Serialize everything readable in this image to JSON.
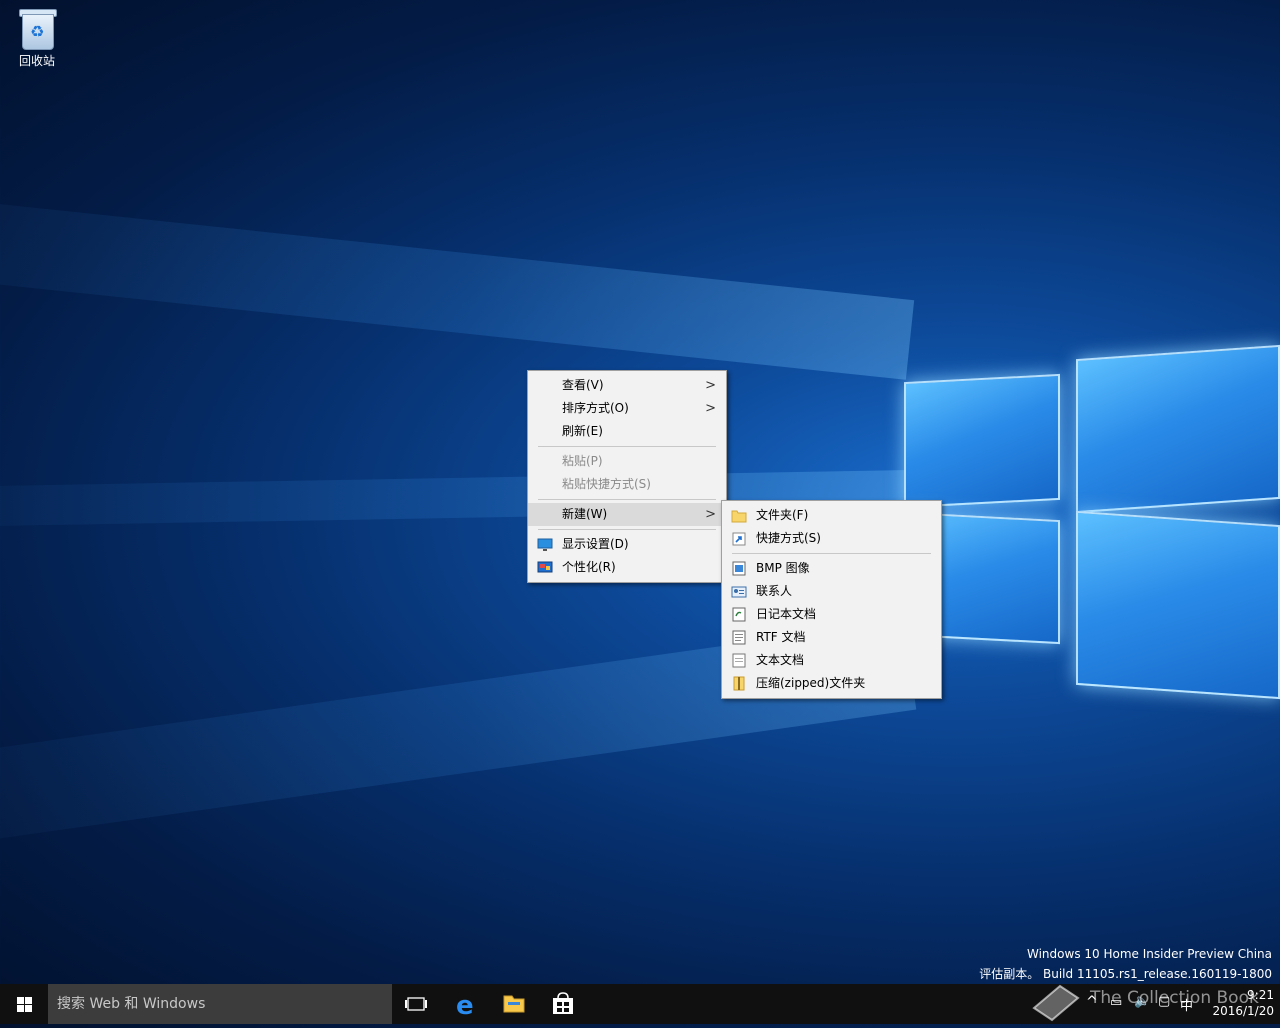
{
  "desktop": {
    "recycle_bin_label": "回收站"
  },
  "context_menu": {
    "items": [
      {
        "label": "查看(V)",
        "has_submenu": true
      },
      {
        "label": "排序方式(O)",
        "has_submenu": true
      },
      {
        "label": "刷新(E)"
      },
      {
        "label": "粘贴(P)",
        "disabled": true
      },
      {
        "label": "粘贴快捷方式(S)",
        "disabled": true
      },
      {
        "label": "新建(W)",
        "has_submenu": true,
        "highlighted": true
      },
      {
        "label": "显示设置(D)",
        "icon": "display-icon"
      },
      {
        "label": "个性化(R)",
        "icon": "personalize-icon"
      }
    ]
  },
  "new_submenu": {
    "items": [
      {
        "label": "文件夹(F)",
        "icon": "folder-icon"
      },
      {
        "label": "快捷方式(S)",
        "icon": "shortcut-icon"
      },
      {
        "label": "BMP 图像",
        "icon": "bmp-image-icon"
      },
      {
        "label": "联系人",
        "icon": "contact-icon"
      },
      {
        "label": "日记本文档",
        "icon": "journal-icon"
      },
      {
        "label": "RTF 文档",
        "icon": "rtf-document-icon"
      },
      {
        "label": "文本文档",
        "icon": "text-document-icon"
      },
      {
        "label": "压缩(zipped)文件夹",
        "icon": "zip-folder-icon"
      }
    ]
  },
  "watermark": {
    "line1": "Windows 10 Home Insider Preview China",
    "line2": "评估副本。 Build 11105.rs1_release.160119-1800"
  },
  "taskbar": {
    "search_placeholder": "搜索 Web 和 Windows",
    "clock_time": "9:21",
    "clock_date": "2016/1/20",
    "ime_label": "中"
  },
  "overlay_brand": "The Collection Book"
}
